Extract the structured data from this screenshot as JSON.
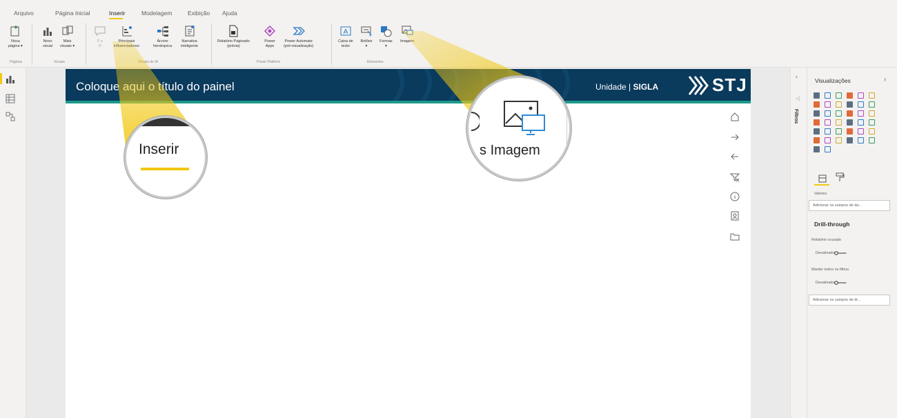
{
  "menu": {
    "items": [
      "Arquivo",
      "Página Inicial",
      "Inserir",
      "Modelagem",
      "Exibição",
      "Ajuda"
    ],
    "active": "Inserir"
  },
  "ribbon": {
    "buttons": {
      "nova_pagina": "Nova\npágina ▾",
      "novo_visual": "Novo\nvisual",
      "mais_visuais": "Mais\nvisuais ▾",
      "p_e": "P e\nR",
      "principais_influenciadores": "Principais\ninfluenciadores",
      "arvore_hierarquica": "Árvore\nhierárquica",
      "narrativa_inteligente": "Narrativa\ninteligente",
      "relatorio_paginado": "Relatório Paginado\n(prévia)",
      "power_apps": "Power\nApps",
      "power_automate": "Power Automate\n(pré-visualização)",
      "caixa_de_texto": "Caixa de\ntexto",
      "botoes": "Botões\n▾",
      "formas": "Formas\n▾",
      "imagem": "Imagem"
    },
    "groups": {
      "pagina": "Páginas",
      "visuais": "Visuais",
      "visuais_ia": "Visuais de IA",
      "power_platform": "Power Platform",
      "elementos": "Elementos"
    }
  },
  "report": {
    "title": "Coloque aqui o título do painel",
    "unit_label": "Unidade | ",
    "unit_sigla": "SIGLA",
    "logo_text": "STJ"
  },
  "callouts": {
    "inserir": "Inserir",
    "imagem": "Imagem",
    "imagem_prefix": "s"
  },
  "filters_panel": {
    "label": "Filtros"
  },
  "viz_panel": {
    "title": "Visualizações",
    "valores_label": "Valores",
    "valores_placeholder": "Adicionar os campos de da...",
    "drillthrough_title": "Drill-through",
    "relatorio_cruzado": "Relatório cruzado",
    "desativado_1": "Desativado",
    "manter_filtros": "Manter todos os filtros",
    "desativado_2": "Desativado",
    "drill_placeholder": "Adicionar os campos de dr..."
  },
  "colors": {
    "accent": "#f2c811",
    "banner": "#0a3a5c",
    "banner_stripe": "#1d9a8a"
  }
}
